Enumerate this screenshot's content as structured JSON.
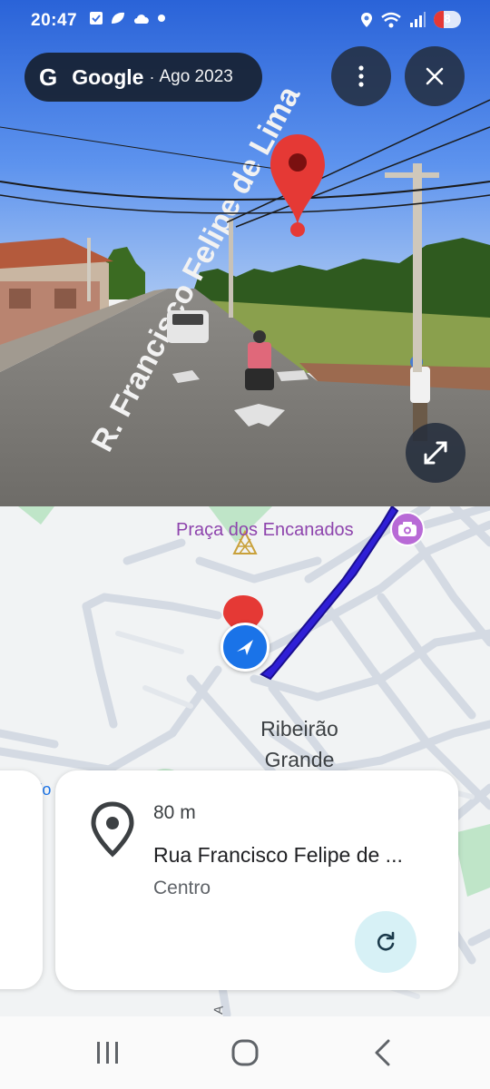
{
  "status_bar": {
    "time": "20:47",
    "battery_level": "8",
    "icons": [
      "check-icon",
      "leaf-icon",
      "cloud-icon",
      "dot-icon",
      "location-icon",
      "wifi-icon",
      "signal-icon",
      "battery-icon"
    ]
  },
  "street_view": {
    "brand": "Google",
    "date": "Ago 2023",
    "separator": "·",
    "road_label": "R. Francisco Felipe de Lima"
  },
  "map": {
    "poi_name": "Praça dos Encanados",
    "town_line1": "Ribeirão",
    "town_line2": "Grande",
    "partial_label": "'o"
  },
  "card": {
    "distance": "80 m",
    "street": "Rua Francisco Felipe de ...",
    "area": "Centro"
  },
  "colors": {
    "route": "#2f1fd6",
    "pin": "#e53935",
    "location": "#1a73e8",
    "poi": "#8e44ad",
    "refresh_bg": "#d7f1f6"
  }
}
